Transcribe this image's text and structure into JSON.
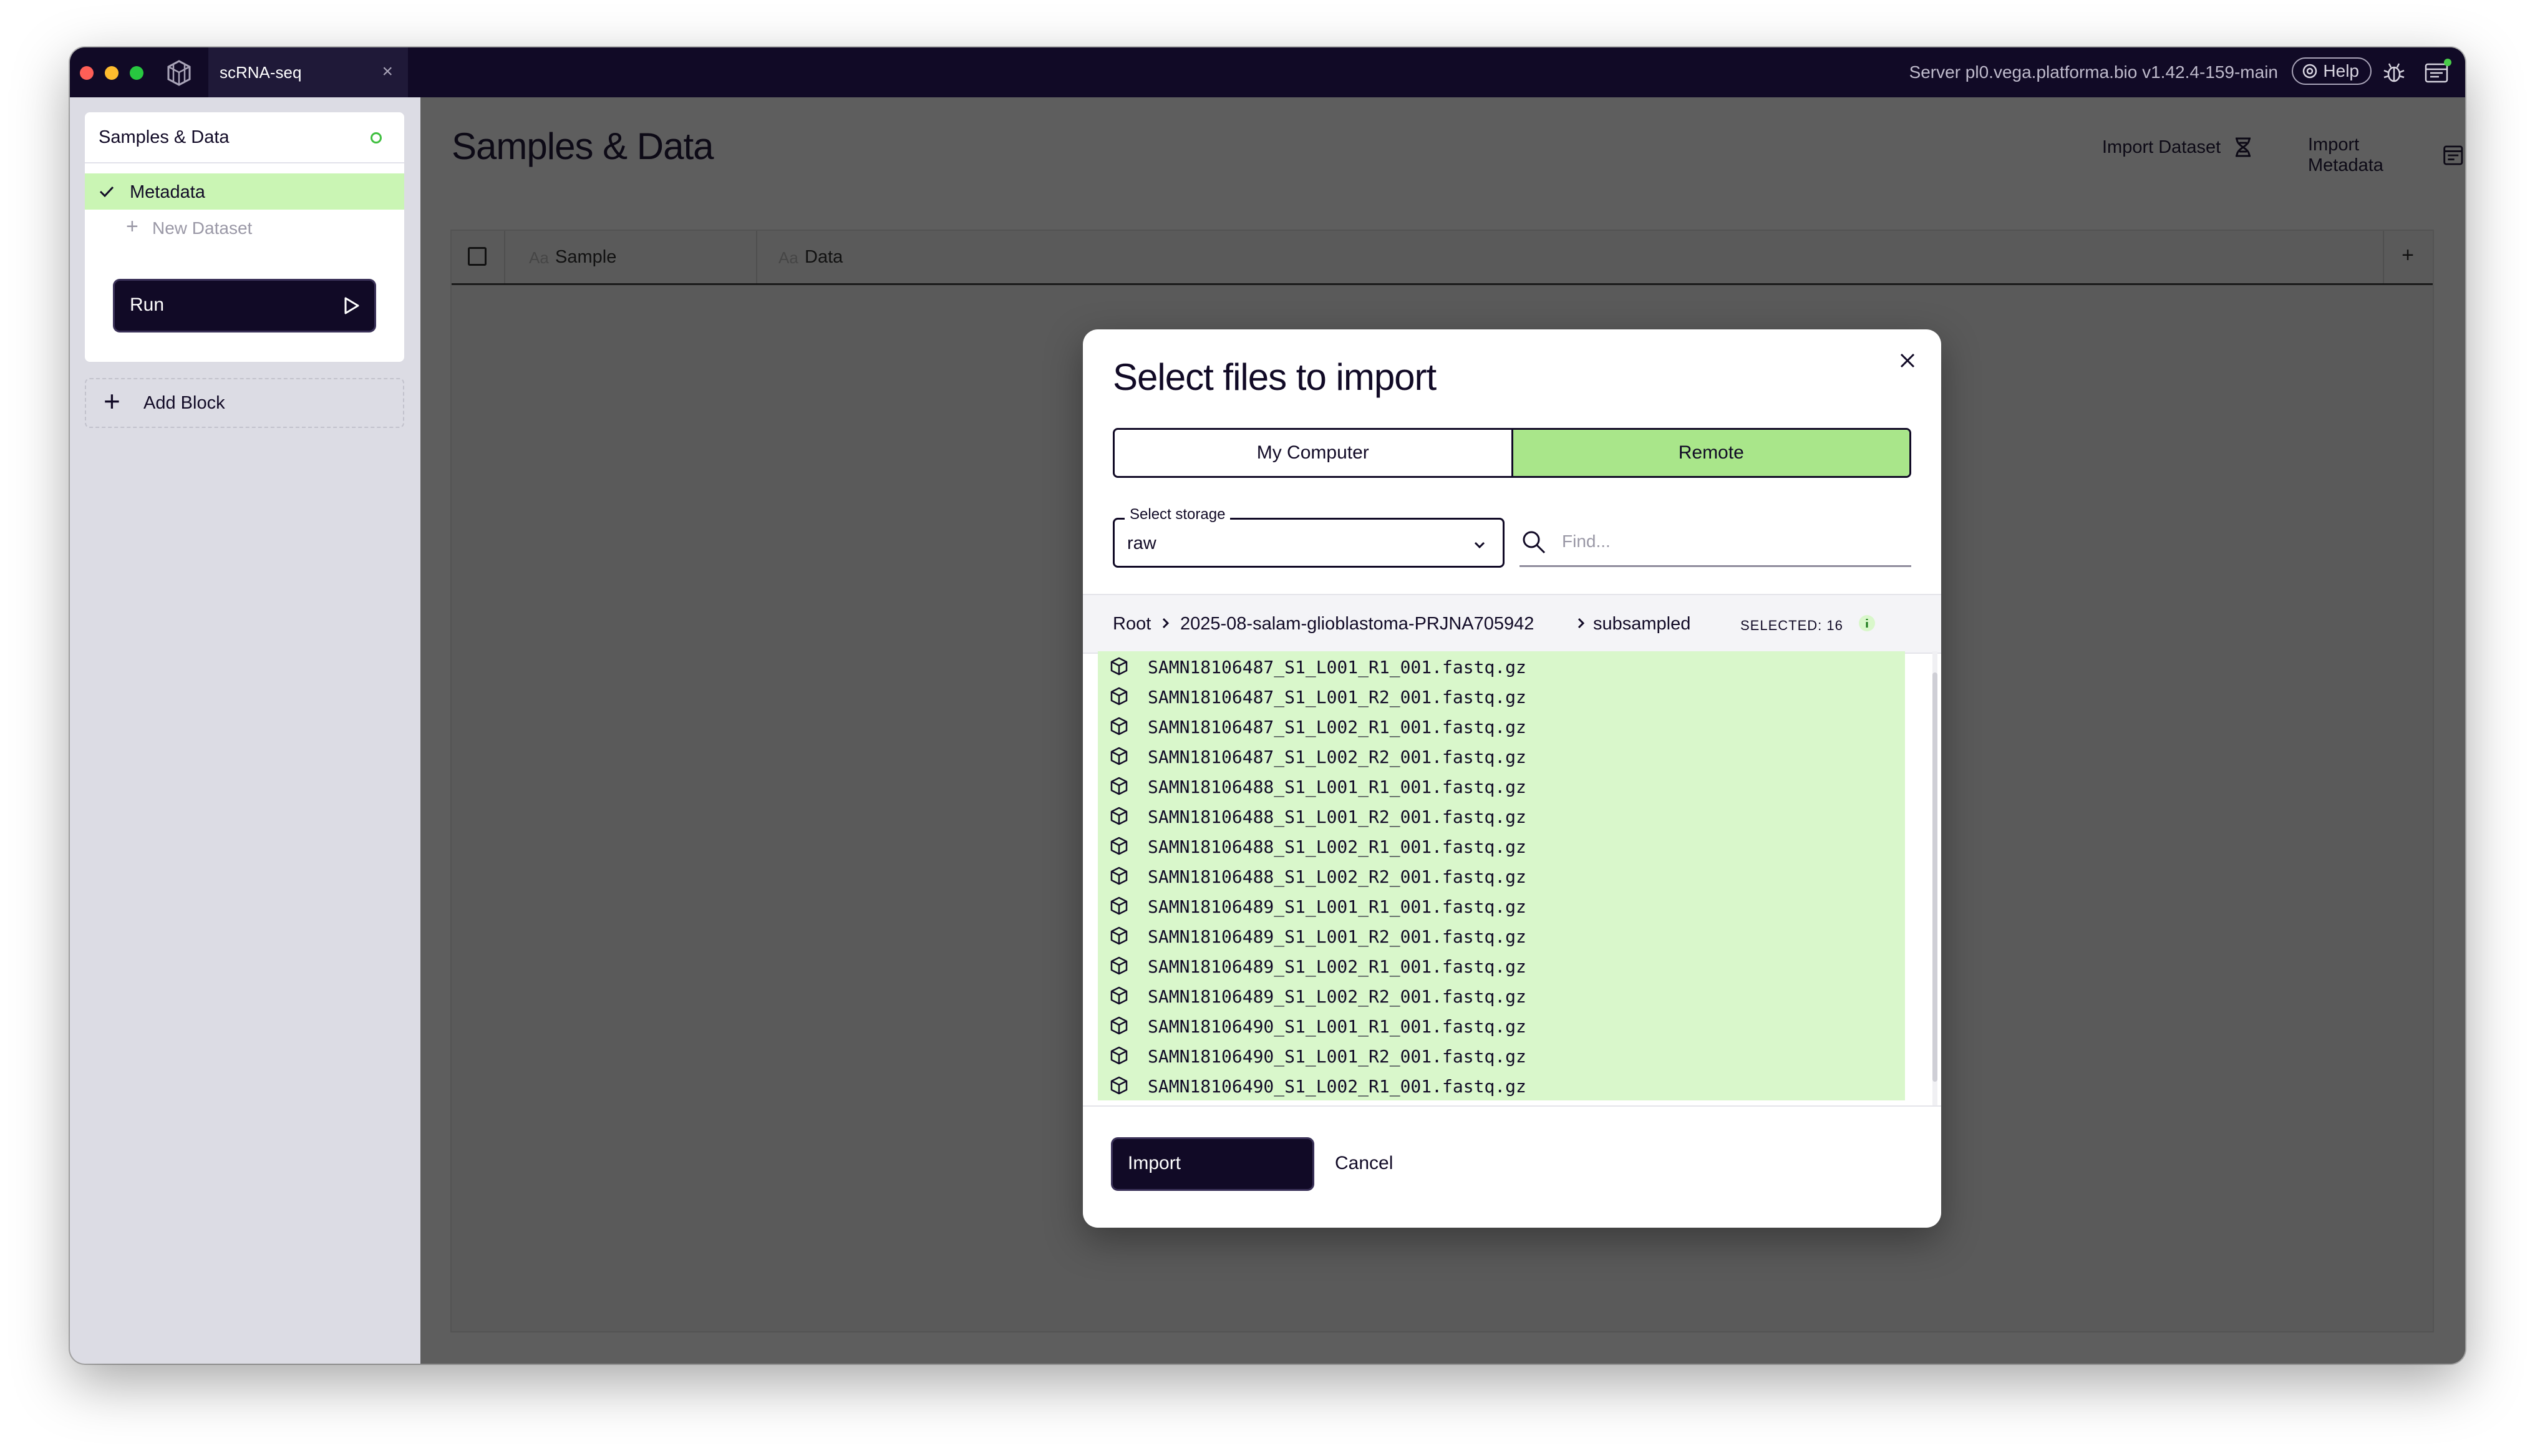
{
  "titlebar": {
    "tab_label": "scRNA-seq",
    "server_text": "Server pl0.vega.platforma.bio v1.42.4-159-main",
    "help_label": "Help"
  },
  "sidebar": {
    "section_title": "Samples & Data",
    "active_item": "Metadata",
    "new_dataset_label": "New Dataset",
    "run_label": "Run",
    "add_block_label": "Add Block"
  },
  "main": {
    "page_title": "Samples & Data",
    "import_dataset_label": "Import Dataset",
    "import_metadata_label": "Import Metadata",
    "columns": [
      {
        "type_glyph": "Aa",
        "name": "Sample"
      },
      {
        "type_glyph": "Aa",
        "name": "Data"
      }
    ],
    "add_column": "+"
  },
  "modal": {
    "title": "Select files to import",
    "tabs": [
      "My Computer",
      "Remote"
    ],
    "active_tab": "Remote",
    "storage_label": "Select storage",
    "storage_value": "raw",
    "find_placeholder": "Find...",
    "breadcrumb": [
      "Root",
      "2025-08-salam-glioblastoma-PRJNA705942",
      "subsampled"
    ],
    "selected_label": "SELECTED: 16",
    "files": [
      "SAMN18106487_S1_L001_R1_001.fastq.gz",
      "SAMN18106487_S1_L001_R2_001.fastq.gz",
      "SAMN18106487_S1_L002_R1_001.fastq.gz",
      "SAMN18106487_S1_L002_R2_001.fastq.gz",
      "SAMN18106488_S1_L001_R1_001.fastq.gz",
      "SAMN18106488_S1_L001_R2_001.fastq.gz",
      "SAMN18106488_S1_L002_R1_001.fastq.gz",
      "SAMN18106488_S1_L002_R2_001.fastq.gz",
      "SAMN18106489_S1_L001_R1_001.fastq.gz",
      "SAMN18106489_S1_L001_R2_001.fastq.gz",
      "SAMN18106489_S1_L002_R1_001.fastq.gz",
      "SAMN18106489_S1_L002_R2_001.fastq.gz",
      "SAMN18106490_S1_L001_R1_001.fastq.gz",
      "SAMN18106490_S1_L001_R2_001.fastq.gz",
      "SAMN18106490_S1_L002_R1_001.fastq.gz"
    ],
    "import_label": "Import",
    "cancel_label": "Cancel"
  },
  "colors": {
    "brand_dark": "#110a26",
    "selection_green": "#d9f7cb",
    "active_tab_green": "#a9e68a",
    "sidebar_active": "#caf5b4"
  },
  "icons": [
    "app-logo-icon",
    "close-icon",
    "help-icon",
    "bug-icon",
    "panel-icon",
    "check-icon",
    "plus-icon",
    "play-icon",
    "dataset-import-icon",
    "metadata-import-icon",
    "chevron-down-icon",
    "search-icon",
    "chevron-right-icon",
    "info-icon",
    "file-box-icon"
  ]
}
